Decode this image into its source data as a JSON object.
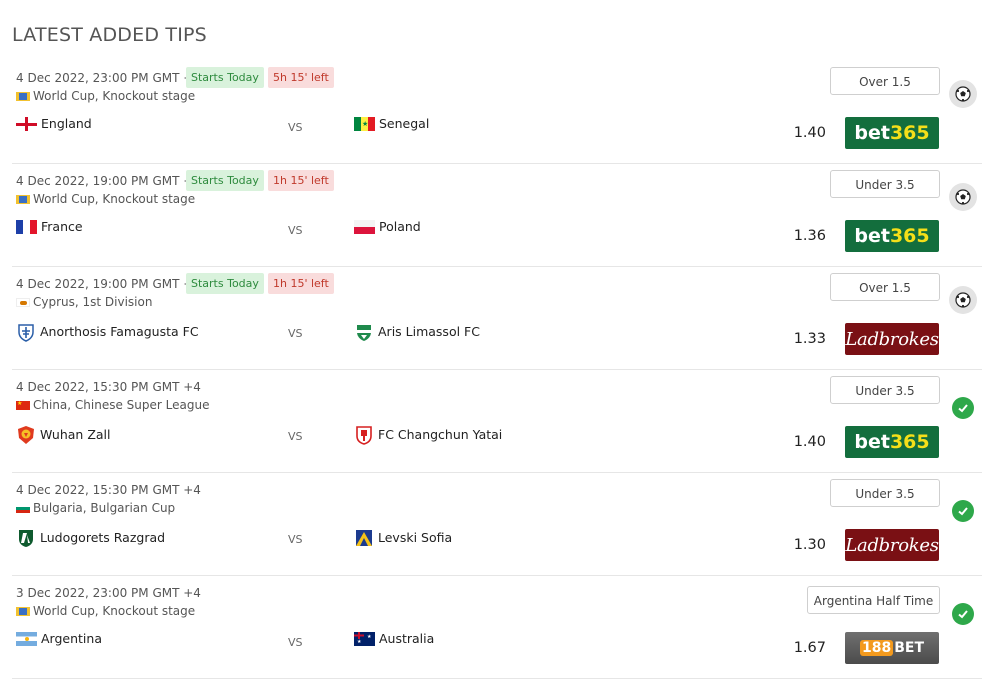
{
  "page": {
    "title": "LATEST ADDED TIPS"
  },
  "tips": [
    {
      "datetime": "4 Dec 2022, 23:00 PM GMT +4",
      "badge_start": "Starts Today",
      "badge_left": "5h 15' left",
      "league": "World Cup, Knockout stage",
      "home": "England",
      "vs": "VS",
      "away": "Senegal",
      "pick": "Over 1.5",
      "odds": "1.40",
      "bookmaker": "bet365",
      "status": "pending"
    },
    {
      "datetime": "4 Dec 2022, 19:00 PM GMT +4",
      "badge_start": "Starts Today",
      "badge_left": "1h 15' left",
      "league": "World Cup, Knockout stage",
      "home": "France",
      "vs": "VS",
      "away": "Poland",
      "pick": "Under 3.5",
      "odds": "1.36",
      "bookmaker": "bet365",
      "status": "pending"
    },
    {
      "datetime": "4 Dec 2022, 19:00 PM GMT +4",
      "badge_start": "Starts Today",
      "badge_left": "1h 15' left",
      "league": "Cyprus, 1st Division",
      "home": "Anorthosis Famagusta FC",
      "vs": "VS",
      "away": "Aris Limassol FC",
      "pick": "Over 1.5",
      "odds": "1.33",
      "bookmaker": "Ladbrokes",
      "status": "pending"
    },
    {
      "datetime": "4 Dec 2022, 15:30 PM GMT +4",
      "league": "China, Chinese Super League",
      "home": "Wuhan Zall",
      "vs": "VS",
      "away": "FC Changchun Yatai",
      "pick": "Under 3.5",
      "odds": "1.40",
      "bookmaker": "bet365",
      "status": "won"
    },
    {
      "datetime": "4 Dec 2022, 15:30 PM GMT +4",
      "league": "Bulgaria, Bulgarian Cup",
      "home": "Ludogorets Razgrad",
      "vs": "VS",
      "away": "Levski Sofia",
      "pick": "Under 3.5",
      "odds": "1.30",
      "bookmaker": "Ladbrokes",
      "status": "won"
    },
    {
      "datetime": "3 Dec 2022, 23:00 PM GMT +4",
      "league": "World Cup, Knockout stage",
      "home": "Argentina",
      "vs": "VS",
      "away": "Australia",
      "pick": "Argentina Half Time",
      "odds": "1.67",
      "bookmaker": "188BET",
      "status": "won"
    }
  ],
  "bookmaker_logos": {
    "bet365": {
      "part1": "bet",
      "part2": "365"
    },
    "ladbrokes": "Ladbrokes",
    "b188": {
      "num": "188",
      "word": "BET"
    }
  },
  "colors": {
    "badge_green_bg": "#d9f2dc",
    "badge_red_bg": "#f9dcdc",
    "bet365": "#136e3d",
    "ladbrokes": "#7a1014",
    "won": "#2ea84a"
  },
  "icons": {
    "pending": "soccer-ball-icon",
    "won": "check-icon"
  }
}
